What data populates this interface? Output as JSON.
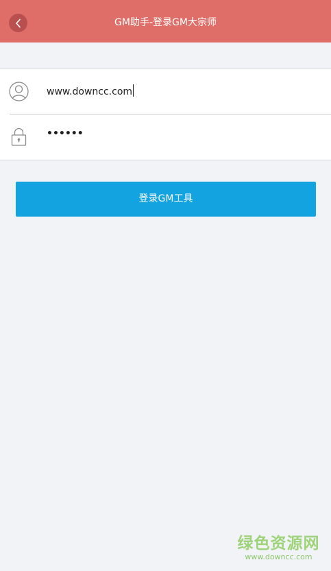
{
  "header": {
    "title": "GM助手-登录GM大宗师",
    "back_icon": "chevron-left-icon",
    "background": "#e06e68",
    "back_button_color": "#b9504f"
  },
  "form": {
    "username": {
      "icon": "user-icon",
      "value": "www.downcc.com"
    },
    "password": {
      "icon": "lock-icon",
      "masked_value": "••••••"
    }
  },
  "login_button": {
    "label": "登录GM工具",
    "color": "#12a3e0"
  },
  "watermark": {
    "brand": "绿色资源网",
    "url": "www.downcc.com"
  }
}
